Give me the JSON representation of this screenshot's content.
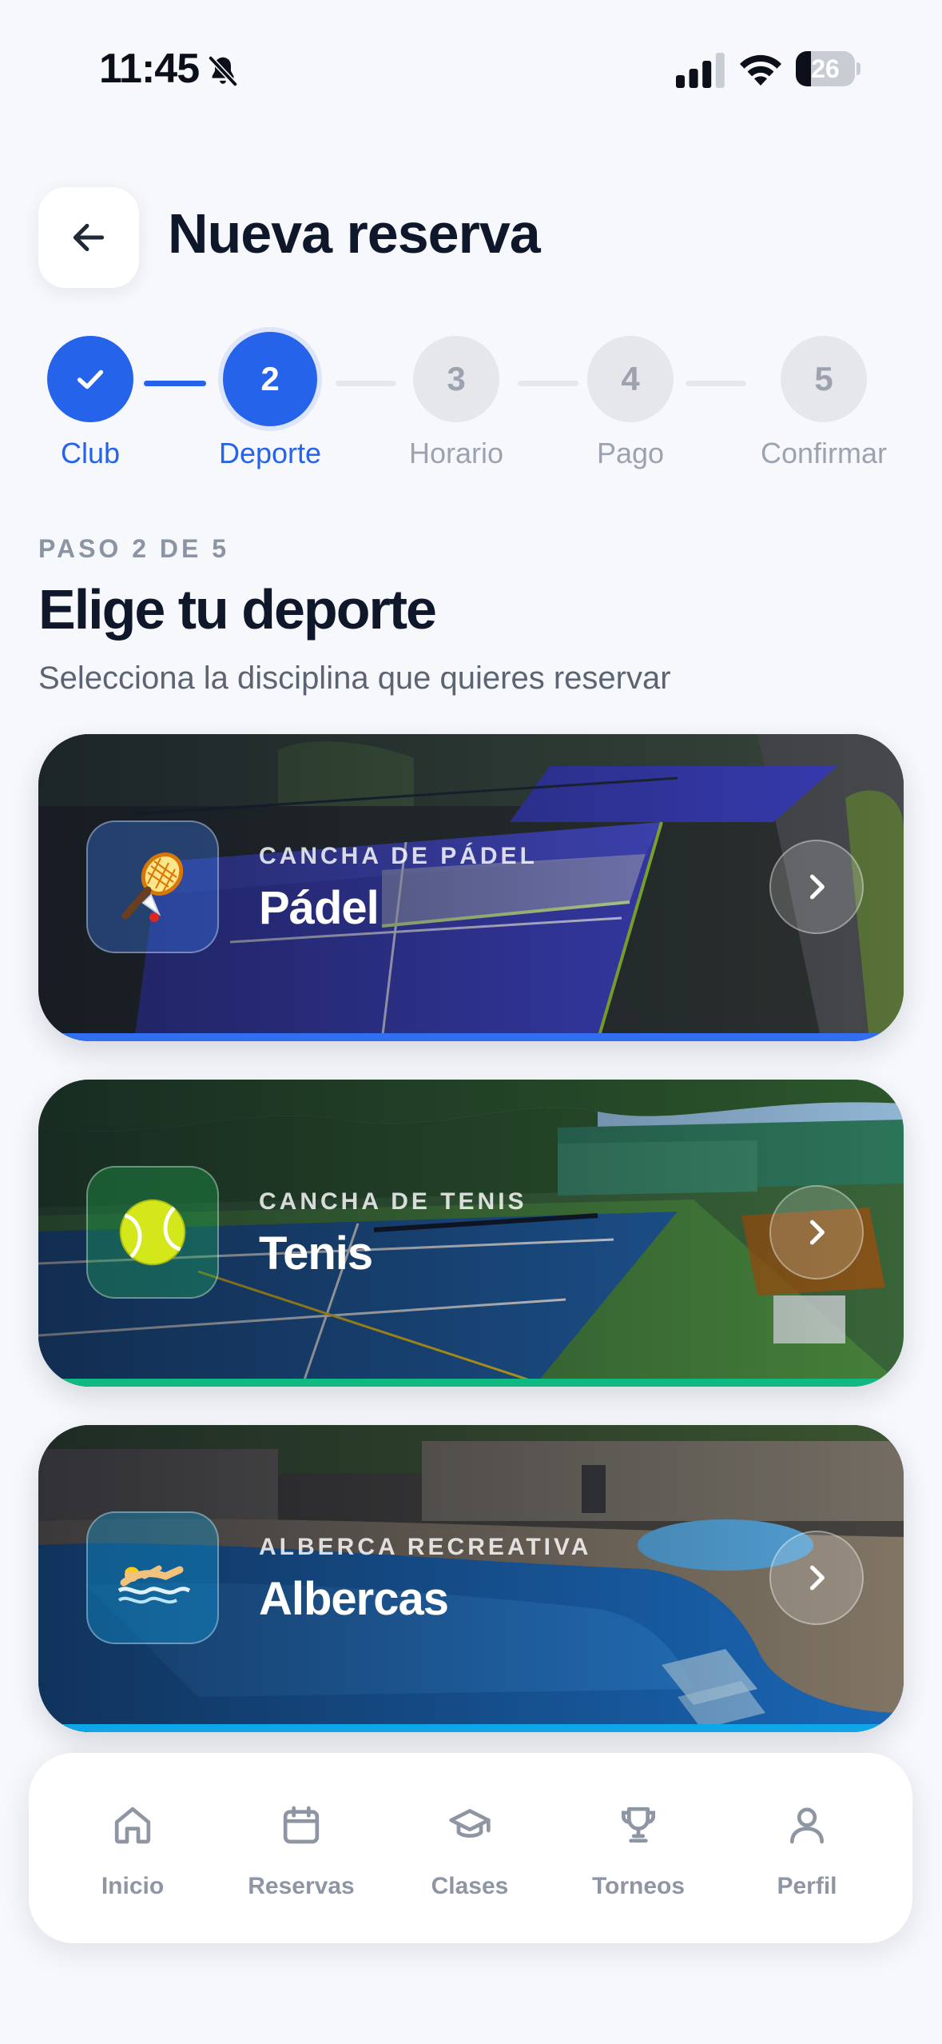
{
  "status_bar": {
    "time": "11:45",
    "battery": "26",
    "battery_level": 0.26,
    "icons": [
      "bell-slash-icon",
      "signal-icon",
      "wifi-icon",
      "battery-icon"
    ]
  },
  "header": {
    "title": "Nueva reserva",
    "back_icon": "arrow-left-icon"
  },
  "stepper": {
    "steps": [
      {
        "number": "1",
        "label": "Club",
        "state": "done"
      },
      {
        "number": "2",
        "label": "Deporte",
        "state": "active"
      },
      {
        "number": "3",
        "label": "Horario",
        "state": "pending"
      },
      {
        "number": "4",
        "label": "Pago",
        "state": "pending"
      },
      {
        "number": "5",
        "label": "Confirmar",
        "state": "pending"
      }
    ],
    "active_color": "#2563eb",
    "pending_color": "#e5e7eb"
  },
  "section": {
    "step_counter": "PASO 2 DE 5",
    "title": "Elige tu deporte",
    "subtitle": "Selecciona la disciplina que quieres reservar"
  },
  "sports": [
    {
      "subtitle": "CANCHA DE PÁDEL",
      "title": "Pádel",
      "icon": "badminton-racket-icon",
      "accent": "#2f6ff0"
    },
    {
      "subtitle": "CANCHA DE TENIS",
      "title": "Tenis",
      "icon": "tennis-ball-icon",
      "accent": "#10b981"
    },
    {
      "subtitle": "ALBERCA RECREATIVA",
      "title": "Albercas",
      "icon": "swimmer-icon",
      "accent": "#0ea5e9"
    }
  ],
  "bottom_nav": {
    "items": [
      {
        "label": "Inicio",
        "icon": "home-icon"
      },
      {
        "label": "Reservas",
        "icon": "calendar-icon"
      },
      {
        "label": "Clases",
        "icon": "graduation-cap-icon"
      },
      {
        "label": "Torneos",
        "icon": "trophy-icon"
      },
      {
        "label": "Perfil",
        "icon": "user-icon"
      }
    ],
    "inactive_color": "#8e96a3"
  }
}
